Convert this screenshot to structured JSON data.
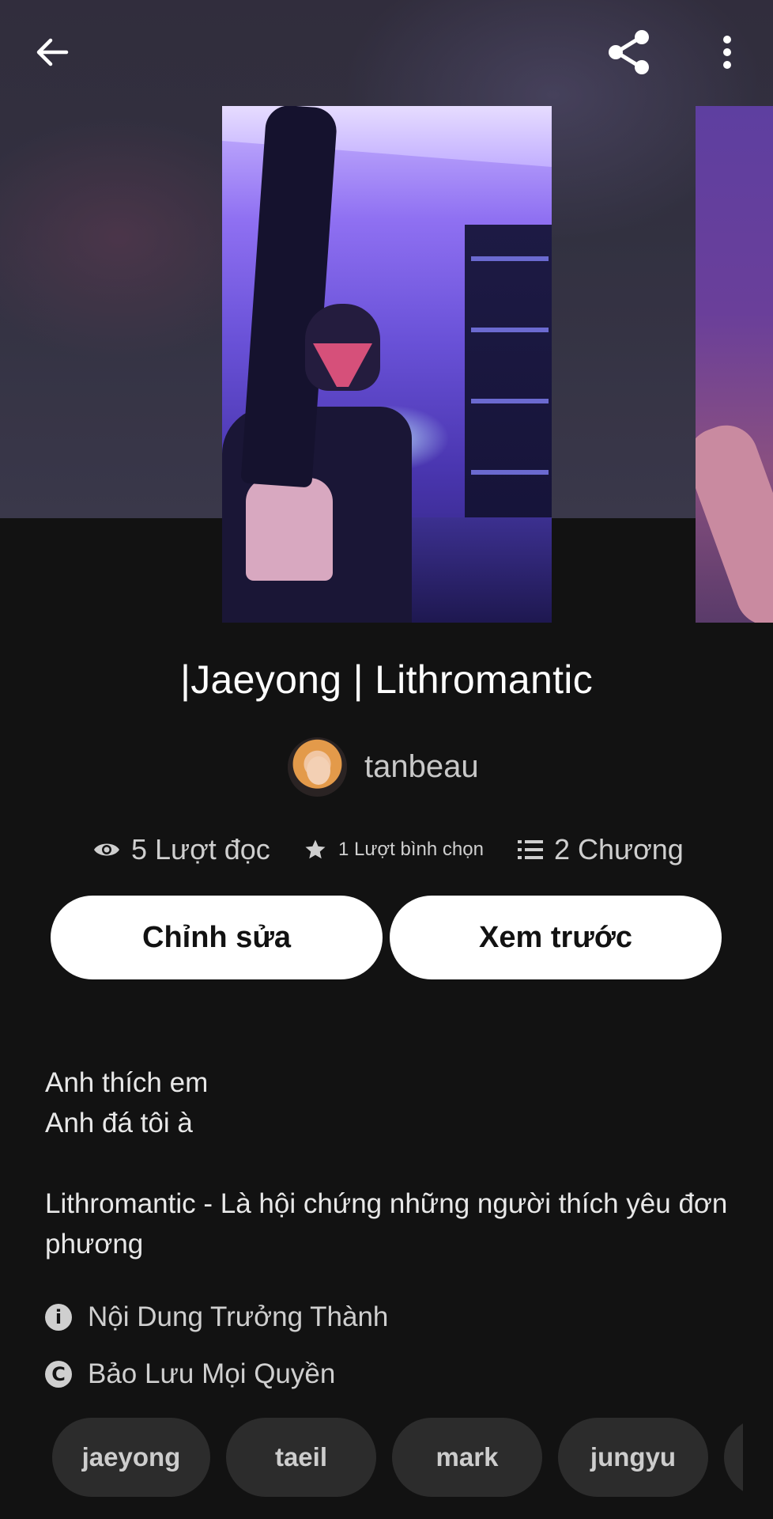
{
  "header": {
    "back_icon": "arrow-left-icon",
    "share_icon": "share-icon",
    "more_icon": "more-vertical-icon"
  },
  "story": {
    "title": "|Jaeyong | Lithromantic",
    "author": "tanbeau"
  },
  "stats": {
    "reads": "5 Lượt đọc",
    "votes": "1 Lượt bình chọn",
    "chapters": "2 Chương"
  },
  "actions": {
    "edit_label": "Chỉnh sửa",
    "preview_label": "Xem trước"
  },
  "description": {
    "line1": "Anh thích em",
    "line2": "Anh đá tôi à",
    "line3": "Lithromantic - Là hội chứng những người thích yêu đơn phương"
  },
  "meta": {
    "mature": "Nội Dung Trưởng Thành",
    "copyright": "Bảo Lưu Mọi Quyền"
  },
  "tags": [
    "jaeyong",
    "taeil",
    "mark",
    "jungyu"
  ],
  "colors": {
    "background": "#121212",
    "button_bg": "#ffffff",
    "tag_bg": "#2c2c2c"
  }
}
